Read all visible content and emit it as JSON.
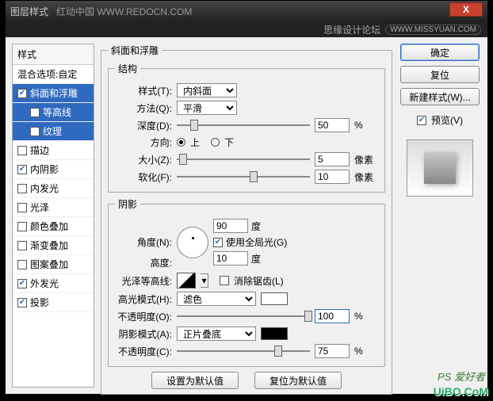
{
  "titlebar": {
    "title": "图层样式",
    "site": "红动中国  WWW.REDOCN.COM",
    "forum": "思缘设计论坛",
    "forum_url": "WWW.MISSYUAN.COM",
    "close": "X"
  },
  "left": {
    "header": "样式",
    "blend": "混合选项:自定",
    "items": [
      {
        "label": "斜面和浮雕",
        "checked": true,
        "sel": true
      },
      {
        "label": "等高线",
        "checked": false,
        "sub": true,
        "sel": true
      },
      {
        "label": "纹理",
        "checked": false,
        "sub": true,
        "sel": true
      },
      {
        "label": "描边",
        "checked": false
      },
      {
        "label": "内阴影",
        "checked": true
      },
      {
        "label": "内发光",
        "checked": false
      },
      {
        "label": "光泽",
        "checked": false
      },
      {
        "label": "颜色叠加",
        "checked": false
      },
      {
        "label": "渐变叠加",
        "checked": false
      },
      {
        "label": "图案叠加",
        "checked": false
      },
      {
        "label": "外发光",
        "checked": true
      },
      {
        "label": "投影",
        "checked": true
      }
    ]
  },
  "panel": {
    "title": "斜面和浮雕",
    "structure": {
      "legend": "结构",
      "style_lbl": "样式(T):",
      "style_val": "内斜面",
      "tech_lbl": "方法(Q):",
      "tech_val": "平滑",
      "depth_lbl": "深度(D):",
      "depth_val": "50",
      "depth_unit": "%",
      "dir_lbl": "方向:",
      "up": "上",
      "down": "下",
      "size_lbl": "大小(Z):",
      "size_val": "5",
      "size_unit": "像素",
      "soft_lbl": "软化(F):",
      "soft_val": "10",
      "soft_unit": "像素"
    },
    "shading": {
      "legend": "阴影",
      "angle_lbl": "角度(N):",
      "angle_val": "90",
      "angle_unit": "度",
      "global": "使用全局光(G)",
      "alt_lbl": "高度:",
      "alt_val": "10",
      "alt_unit": "度",
      "gloss_lbl": "光泽等高线:",
      "aa": "消除锯齿(L)",
      "hmode_lbl": "高光模式(H):",
      "hmode_val": "滤色",
      "hopac_lbl": "不透明度(O):",
      "hopac_val": "100",
      "hopac_unit": "%",
      "smode_lbl": "阴影模式(A):",
      "smode_val": "正片叠底",
      "sopac_lbl": "不透明度(C):",
      "sopac_val": "75",
      "sopac_unit": "%"
    },
    "defaults": {
      "make": "设置为默认值",
      "reset": "复位为默认值"
    }
  },
  "right": {
    "ok": "确定",
    "cancel": "复位",
    "newstyle": "新建样式(W)...",
    "preview": "预览(V)"
  },
  "watermark": {
    "a": "PS 爱好者",
    "b": "UiBO.CoM"
  }
}
